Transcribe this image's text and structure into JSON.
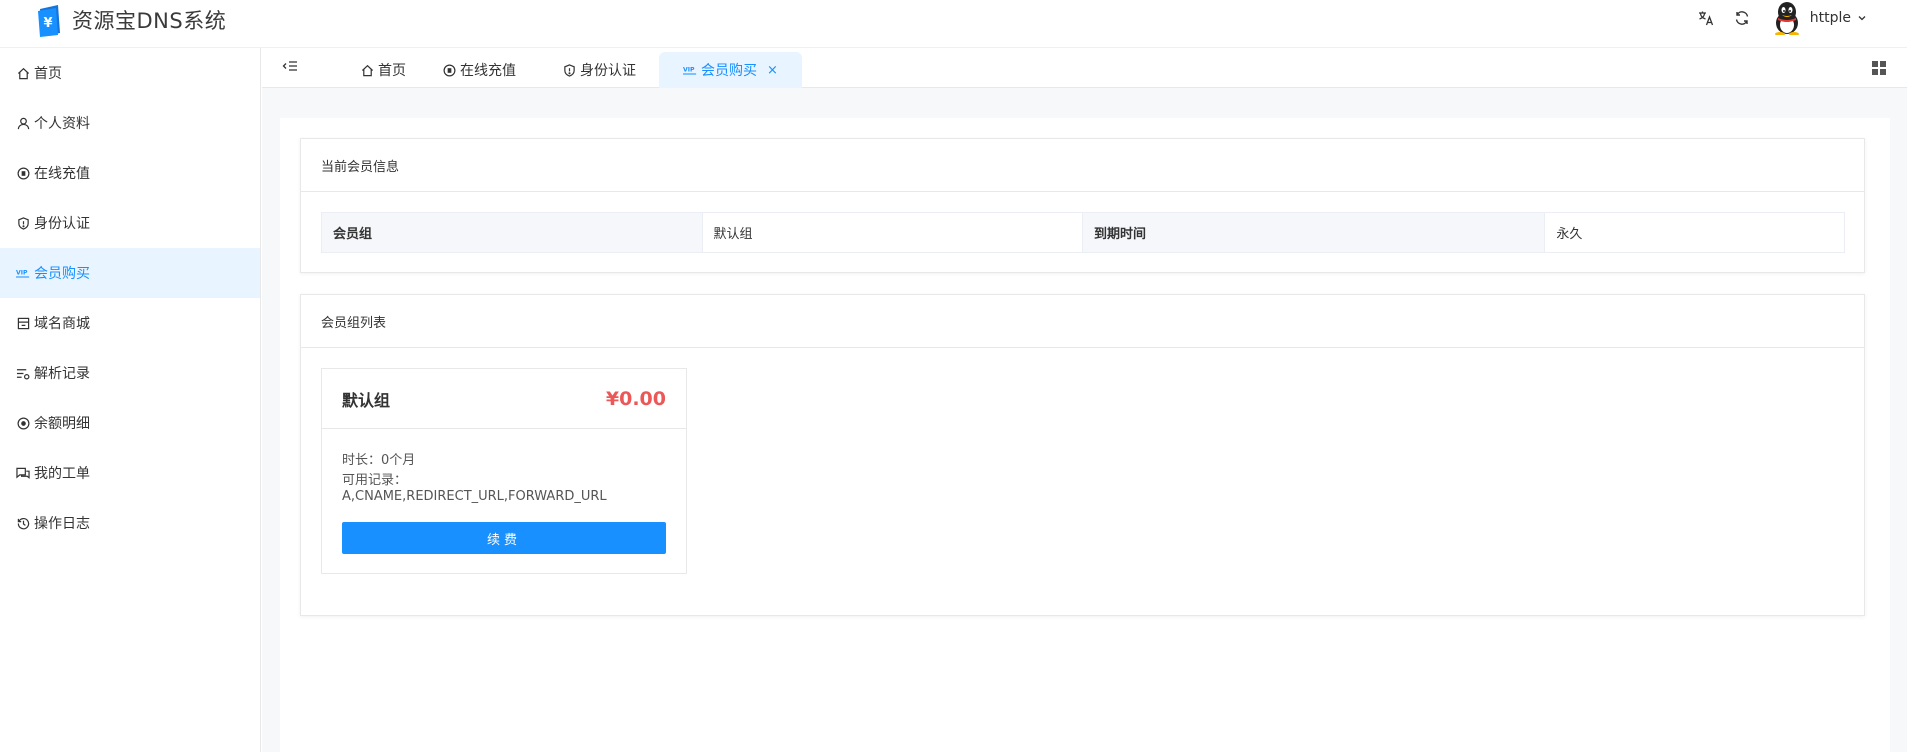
{
  "app": {
    "title": "资源宝DNS系统",
    "logo_symbol": "¥"
  },
  "header": {
    "username": "httple"
  },
  "sidebar": {
    "items": [
      {
        "label": "首页",
        "icon": "home-icon"
      },
      {
        "label": "个人资料",
        "icon": "user-icon"
      },
      {
        "label": "在线充值",
        "icon": "coin-icon"
      },
      {
        "label": "身份认证",
        "icon": "shield-icon"
      },
      {
        "label": "会员购买",
        "icon": "vip-icon",
        "active": true
      },
      {
        "label": "域名商城",
        "icon": "shop-icon"
      },
      {
        "label": "解析记录",
        "icon": "record-list-icon"
      },
      {
        "label": "余额明细",
        "icon": "balance-icon"
      },
      {
        "label": "我的工单",
        "icon": "ticket-icon"
      },
      {
        "label": "操作日志",
        "icon": "history-icon"
      }
    ]
  },
  "tabs": [
    {
      "label": "首页",
      "icon": "home-icon"
    },
    {
      "label": "在线充值",
      "icon": "coin-icon"
    },
    {
      "label": "身份认证",
      "icon": "shield-icon"
    },
    {
      "label": "会员购买",
      "icon": "vip-icon",
      "active": true,
      "close": "×"
    }
  ],
  "member_info": {
    "title": "当前会员信息",
    "group_label": "会员组",
    "group_value": "默认组",
    "expire_label": "到期时间",
    "expire_value": "永久"
  },
  "group_list": {
    "title": "会员组列表",
    "plans": [
      {
        "name": "默认组",
        "price": "¥0.00",
        "duration": "时长：0个月",
        "records_label": "可用记录：",
        "records_value": "A,CNAME,REDIRECT_URL,FORWARD_URL",
        "button": "续费"
      }
    ]
  },
  "colors": {
    "accent": "#1890ff",
    "active_bg": "#e8f4ff",
    "price": "#ec5757"
  }
}
